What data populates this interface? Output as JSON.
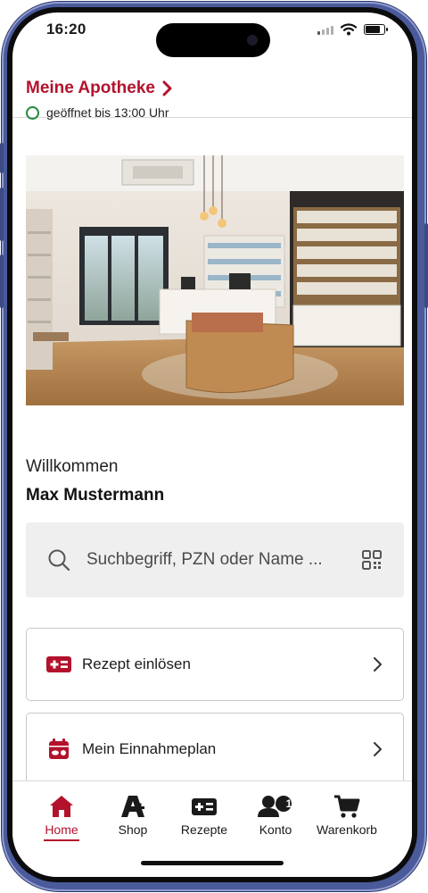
{
  "status_bar": {
    "time": "16:20"
  },
  "pharmacy": {
    "name": "Meine Apotheke",
    "opening_status": "geöffnet bis 13:00 Uhr",
    "status_color": "#1f8a3a"
  },
  "hero": {
    "image": "pharmacy-interior"
  },
  "welcome": {
    "greeting": "Willkommen",
    "user_name": "Max Mustermann"
  },
  "search": {
    "placeholder": "Suchbegriff, PZN oder Name ..."
  },
  "actions": [
    {
      "label": "Rezept einlösen",
      "icon": "prescription-card-icon"
    },
    {
      "label": "Mein Einnahmeplan",
      "icon": "medication-calendar-icon"
    }
  ],
  "bottom_nav": {
    "items": [
      {
        "label": "Home",
        "icon": "home-icon",
        "active": true
      },
      {
        "label": "Shop",
        "icon": "pharmacy-a-icon"
      },
      {
        "label": "Rezepte",
        "icon": "prescription-card-icon"
      },
      {
        "label": "Konto",
        "icon": "account-icon",
        "badge": "1"
      },
      {
        "label": "Warenkorb",
        "icon": "cart-icon"
      }
    ]
  },
  "colors": {
    "accent": "#b3122d",
    "frame": "#4a5a9a"
  }
}
